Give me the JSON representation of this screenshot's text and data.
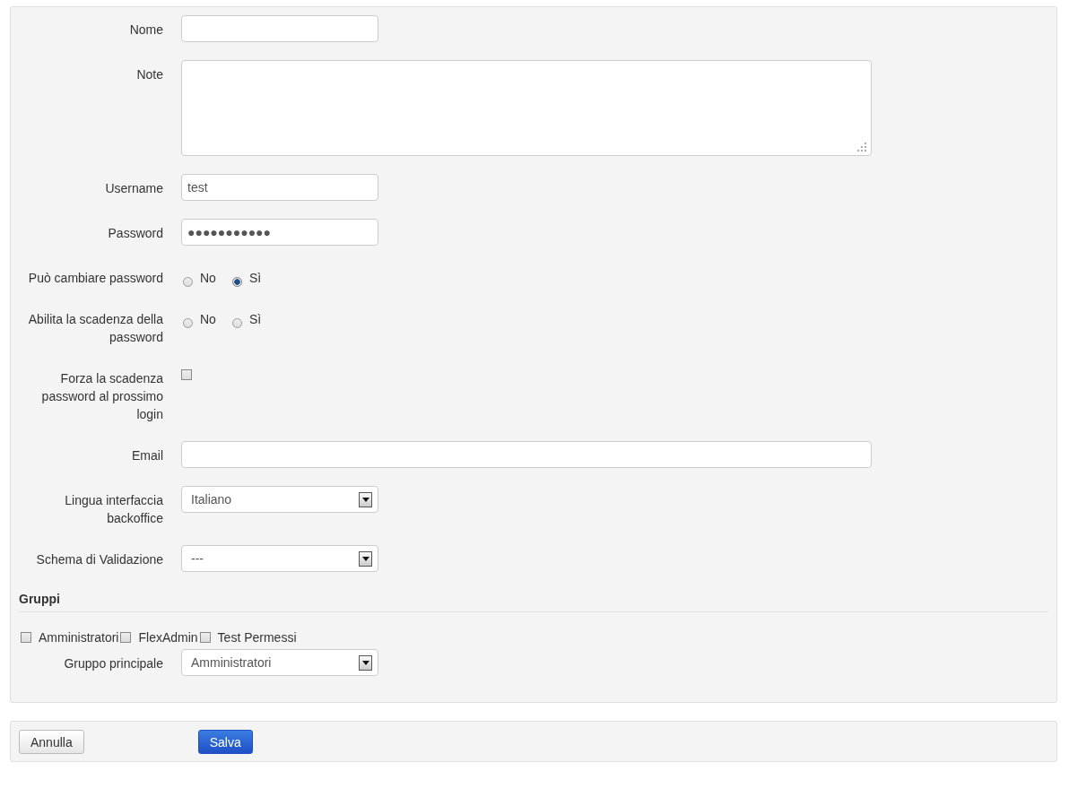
{
  "fields": [
    {
      "kind": "text",
      "label": "Nome",
      "wide": false
    },
    {
      "kind": "textarea",
      "label": "Note"
    },
    {
      "kind": "text",
      "label": "Username",
      "value": "test",
      "wide": false
    },
    {
      "kind": "text",
      "label": "Password",
      "value": "●●●●●●●●●●●",
      "wide": false
    },
    {
      "kind": "radio",
      "label": "Può cambiare password",
      "options": [
        {
          "label": "No",
          "selected": false
        },
        {
          "label": "Sì",
          "selected": true
        }
      ]
    },
    {
      "kind": "radio",
      "label": "Abilita la scadenza della password",
      "options": [
        {
          "label": "No",
          "selected": false
        },
        {
          "label": "Sì",
          "selected": false
        }
      ]
    },
    {
      "kind": "checkbox",
      "label": "Forza la scadenza password al prossimo login",
      "checked": false
    },
    {
      "kind": "text",
      "label": "Email",
      "wide": true
    },
    {
      "kind": "select",
      "label": "Lingua interfaccia backoffice",
      "value": "Italiano"
    },
    {
      "kind": "select",
      "label": "Schema di Validazione",
      "value": "---"
    }
  ],
  "groups": {
    "title": "Gruppi",
    "items": [
      {
        "label": "Amministratori",
        "checked": false
      },
      {
        "label": "FlexAdmin",
        "checked": false
      },
      {
        "label": "Test Permessi",
        "checked": false
      }
    ],
    "main_group": {
      "label": "Gruppo principale",
      "value": "Amministratori"
    }
  },
  "buttons": {
    "cancel": "Annulla",
    "save": "Salva"
  }
}
